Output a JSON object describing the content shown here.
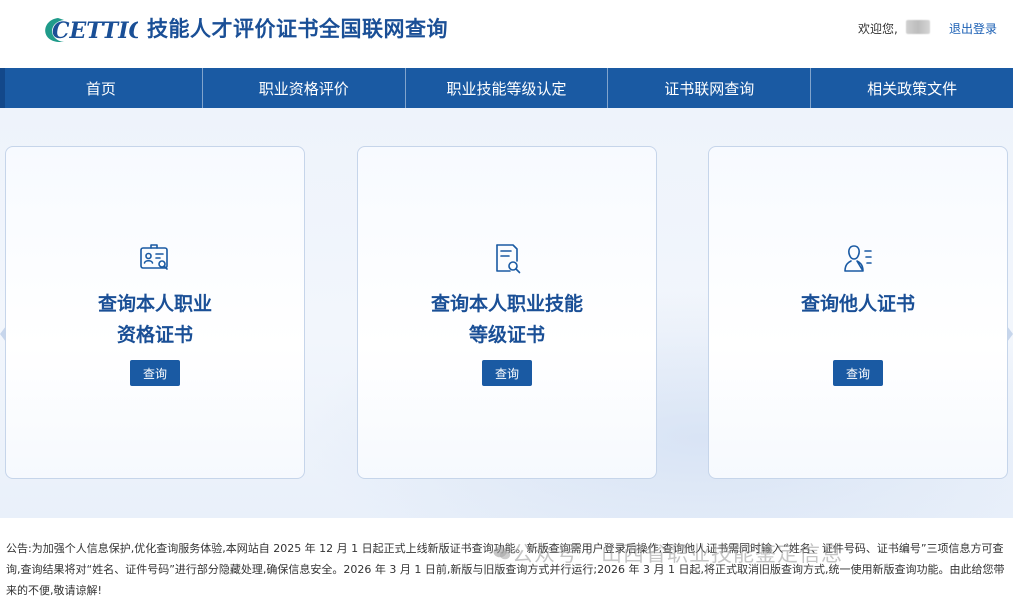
{
  "header": {
    "logo_text": "CETTIC",
    "site_title": "技能人才评价证书全国联网查询",
    "welcome_text": "欢迎您,",
    "logout_label": "退出登录"
  },
  "nav": {
    "items": [
      {
        "label": "首页"
      },
      {
        "label": "职业资格评价"
      },
      {
        "label": "职业技能等级认定"
      },
      {
        "label": "证书联网查询"
      },
      {
        "label": "相关政策文件"
      }
    ]
  },
  "cards": [
    {
      "title_line1": "查询本人职业",
      "title_line2": "资格证书",
      "button_label": "查询",
      "icon": "id-card-search-icon"
    },
    {
      "title_line1": "查询本人职业技能",
      "title_line2": "等级证书",
      "button_label": "查询",
      "icon": "document-search-icon"
    },
    {
      "title_line1": "查询他人证书",
      "title_line2": "",
      "button_label": "查询",
      "icon": "user-list-icon"
    }
  ],
  "notice": {
    "text": "公告:为加强个人信息保护,优化查询服务体验,本网站自 2025 年 12 月 1 日起正式上线新版证书查询功能。新版查询需用户登录后操作,查询他人证书需同时输入“姓名、证件号码、证书编号”三项信息方可查询,查询结果将对“姓名、证件号码”进行部分隐藏处理,确保信息安全。2026 年 3 月 1 日前,新版与旧版查询方式并行运行;2026 年 3 月 1 日起,将正式取消旧版查询方式,统一使用新版查询功能。由此给您带来的不便,敬请谅解!"
  },
  "watermark": {
    "text": "公众号 · 山西省职业技能鉴定信息"
  },
  "colors": {
    "brand_blue": "#1a5aa3",
    "title_blue": "#1a4f96",
    "logo_teal": "#1f9b8a"
  }
}
